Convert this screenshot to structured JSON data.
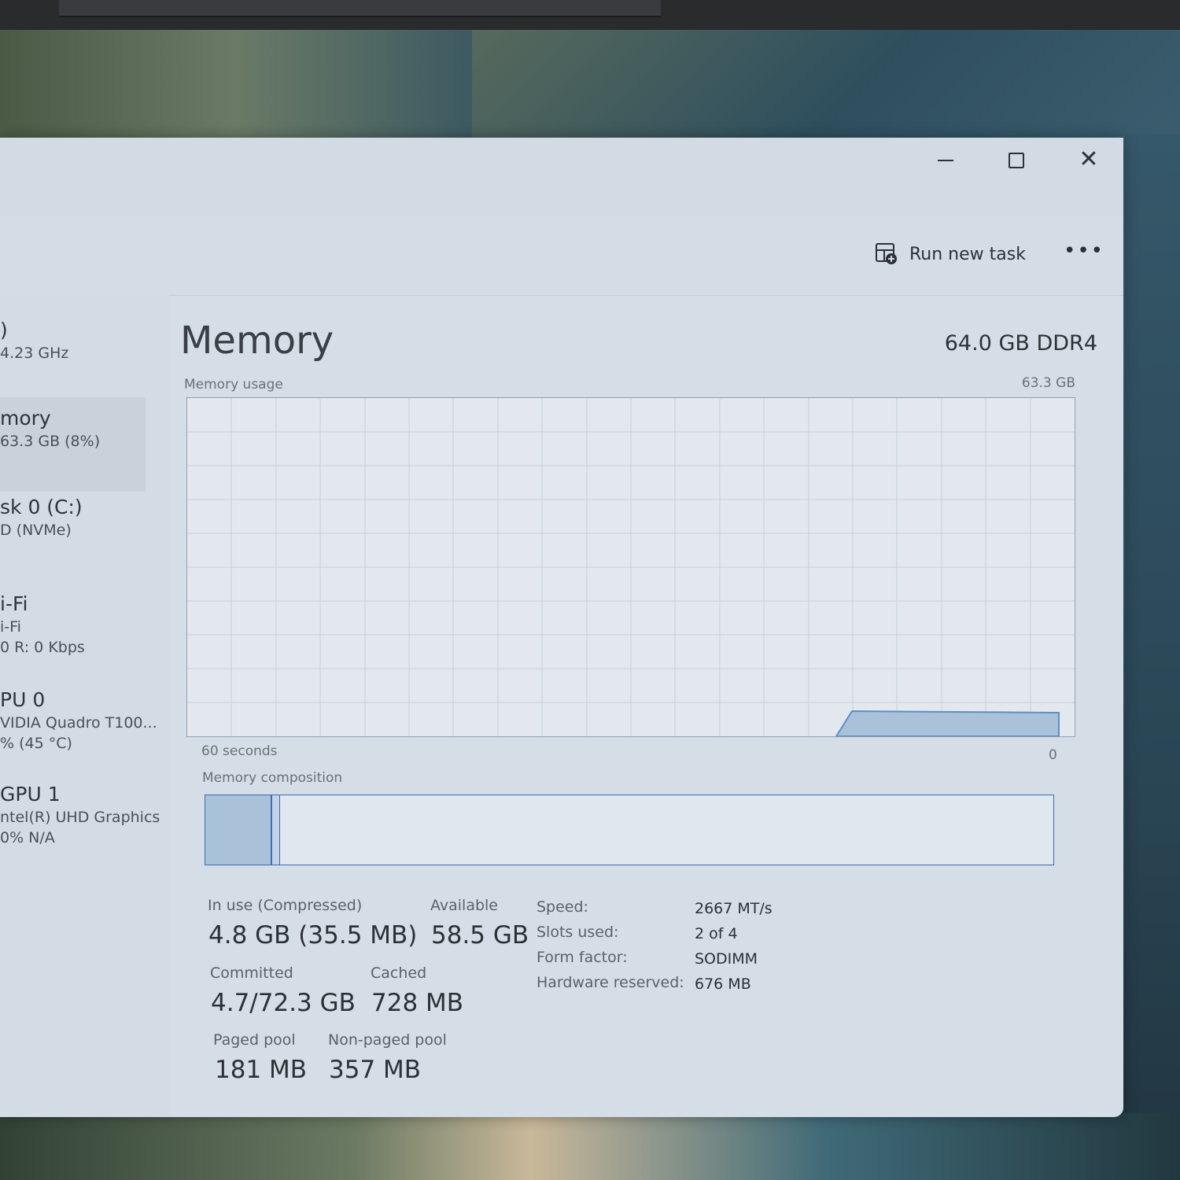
{
  "window": {
    "controls": {
      "minimize": "minimize",
      "maximize": "maximize",
      "close": "close"
    }
  },
  "toolbar": {
    "run_new_task": "Run new task",
    "more": "•••"
  },
  "sidebar": {
    "items": [
      {
        "name": ")",
        "sub1": "4.23 GHz"
      },
      {
        "name": "mory",
        "sub1": "63.3 GB (8%)"
      },
      {
        "name": "sk 0 (C:)",
        "sub1": "D (NVMe)"
      },
      {
        "name": "i-Fi",
        "sub1": "i-Fi",
        "sub2": "0 R: 0 Kbps"
      },
      {
        "name": "PU 0",
        "sub1": "VIDIA Quadro T100...",
        "sub2": "% (45 °C)"
      },
      {
        "name": "GPU 1",
        "sub1": "ntel(R) UHD Graphics",
        "sub2": "0% N/A"
      }
    ]
  },
  "main": {
    "title": "Memory",
    "spec": "64.0 GB DDR4",
    "usage_label": "Memory usage",
    "usage_max": "63.3 GB",
    "time_left": "60 seconds",
    "time_right": "0",
    "composition_label": "Memory composition",
    "stats": {
      "in_use_label": "In use (Compressed)",
      "in_use_value": "4.8 GB (35.5 MB)",
      "available_label": "Available",
      "available_value": "58.5 GB",
      "committed_label": "Committed",
      "committed_value": "4.7/72.3 GB",
      "cached_label": "Cached",
      "cached_value": "728 MB",
      "paged_label": "Paged pool",
      "paged_value": "181 MB",
      "nonpaged_label": "Non-paged pool",
      "nonpaged_value": "357 MB"
    },
    "details": {
      "speed_label": "Speed:",
      "speed_value": "2667 MT/s",
      "slots_label": "Slots used:",
      "slots_value": "2 of 4",
      "form_label": "Form factor:",
      "form_value": "SODIMM",
      "hw_label": "Hardware reserved:",
      "hw_value": "676 MB"
    }
  },
  "colors": {
    "accent": "#3c6db3",
    "graph_fill": "#a9c1d9",
    "window_bg": "#d5dde6"
  }
}
